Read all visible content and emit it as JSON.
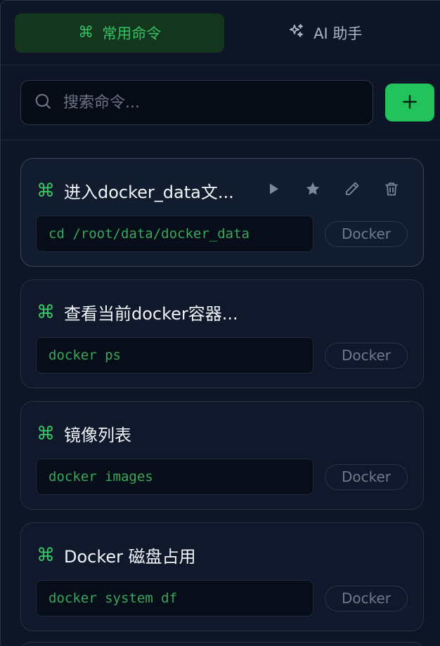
{
  "tabs": {
    "common": {
      "icon": "command-icon",
      "label": "常用命令"
    },
    "ai": {
      "icon": "sparkles-icon",
      "label": "AI 助手"
    }
  },
  "search": {
    "placeholder": "搜索命令..."
  },
  "add_button": {
    "icon": "plus-icon"
  },
  "commands": [
    {
      "title": "进入docker_data文...",
      "command": "cd /root/data/docker_data",
      "tag": "Docker"
    },
    {
      "title": "查看当前docker容器...",
      "command": "docker ps",
      "tag": "Docker"
    },
    {
      "title": "镜像列表",
      "command": "docker images",
      "tag": "Docker"
    },
    {
      "title": "Docker 磁盘占用",
      "command": "docker system df",
      "tag": "Docker"
    }
  ],
  "colors": {
    "accent": "#22c35c",
    "accent_text": "#34c262",
    "background": "#0d1526",
    "card": "#0f192b"
  }
}
